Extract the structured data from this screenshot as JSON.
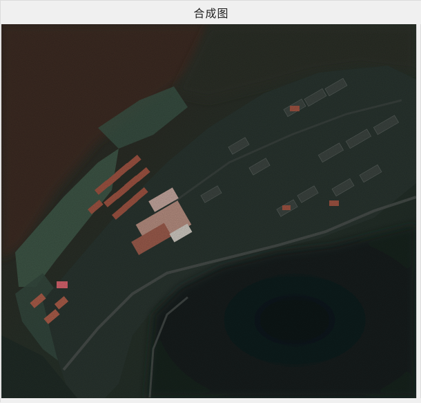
{
  "window": {
    "title": "合成图"
  },
  "image": {
    "icon": "satellite-composite-image",
    "colors": {
      "forest_dark": "#1b2824",
      "forest_brown": "#3a2a22",
      "reservoir": "#121c1d",
      "field_green": "#3e5b4c",
      "roof_red": "#9a5040",
      "roof_light": "#c9a79a",
      "road": "#4a4e4c"
    }
  }
}
